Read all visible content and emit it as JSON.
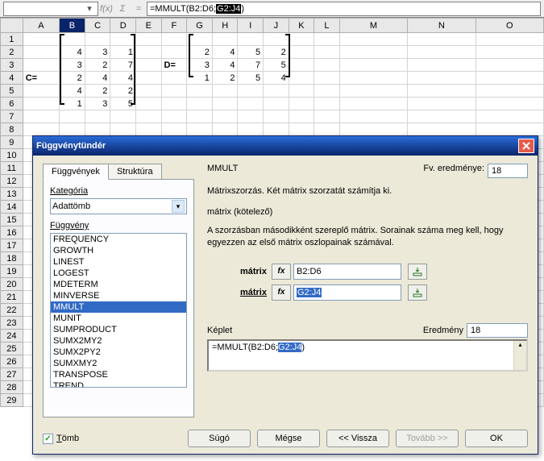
{
  "formula_bar": {
    "prefix": "=MMULT(B2:D6;",
    "sel": "G2:J4",
    "suffix": ")"
  },
  "fx_label": "f(x)",
  "sigma": "Σ",
  "eq": "=",
  "cols": [
    "A",
    "B",
    "C",
    "D",
    "E",
    "F",
    "G",
    "H",
    "I",
    "J",
    "K",
    "L",
    "M",
    "N",
    "O"
  ],
  "rows": [
    1,
    2,
    3,
    4,
    5,
    6,
    7,
    8,
    9,
    10,
    11,
    12,
    13,
    14,
    15,
    16,
    17,
    18,
    19,
    20,
    21,
    22,
    23,
    24,
    25,
    26,
    27,
    28,
    29
  ],
  "sel_col": "B",
  "cells": {
    "A4": "C=",
    "F3": "D=",
    "B2": "4",
    "C2": "3",
    "D2": "1",
    "B3": "3",
    "C3": "2",
    "D3": "7",
    "B4": "2",
    "C4": "4",
    "D4": "4",
    "B5": "4",
    "C5": "2",
    "D5": "2",
    "B6": "1",
    "C6": "3",
    "D6": "5",
    "G2": "2",
    "H2": "4",
    "I2": "5",
    "J2": "2",
    "G3": "3",
    "H3": "4",
    "I3": "7",
    "J3": "5",
    "G4": "1",
    "H4": "2",
    "I4": "5",
    "J4": "4"
  },
  "dialog": {
    "title": "Függvénytündér",
    "tabs": {
      "functions": "Függvények",
      "structure": "Struktúra"
    },
    "category_label": "Kategória",
    "category_value": "Adattömb",
    "function_label": "Függvény",
    "functions": [
      "FREQUENCY",
      "GROWTH",
      "LINEST",
      "LOGEST",
      "MDETERM",
      "MINVERSE",
      "MMULT",
      "MUNIT",
      "SUMPRODUCT",
      "SUMX2MY2",
      "SUMX2PY2",
      "SUMXMY2",
      "TRANSPOSE",
      "TREND"
    ],
    "selected_function": "MMULT",
    "fname": "MMULT",
    "fv_label": "Fv. eredménye:",
    "fv_value": "18",
    "desc": "Mátrixszorzás. Két mátrix szorzatát számítja ki.",
    "arg_title": "mátrix (kötelező)",
    "arg_help": "A szorzásban másodikként szereplő mátrix. Sorainak száma meg kell, hogy egyezzen az első mátrix oszlopainak számával.",
    "arg1_label": "mátrix",
    "arg1_value": "B2:D6",
    "arg2_label": "mátrix",
    "arg2_value": "G2:J4",
    "fx": "fx",
    "keplet_label": "Képlet",
    "eredmeny_label": "Eredmény",
    "eredmeny_value": "18",
    "formula_prefix": "=MMULT(B2:D6;",
    "formula_sel": "G2:J4",
    "formula_suffix": ")",
    "array_checkbox": "Tömb",
    "buttons": {
      "help": "Súgó",
      "cancel": "Mégse",
      "back": "<<  Vissza",
      "next": "Tovább >>",
      "ok": "OK"
    }
  }
}
